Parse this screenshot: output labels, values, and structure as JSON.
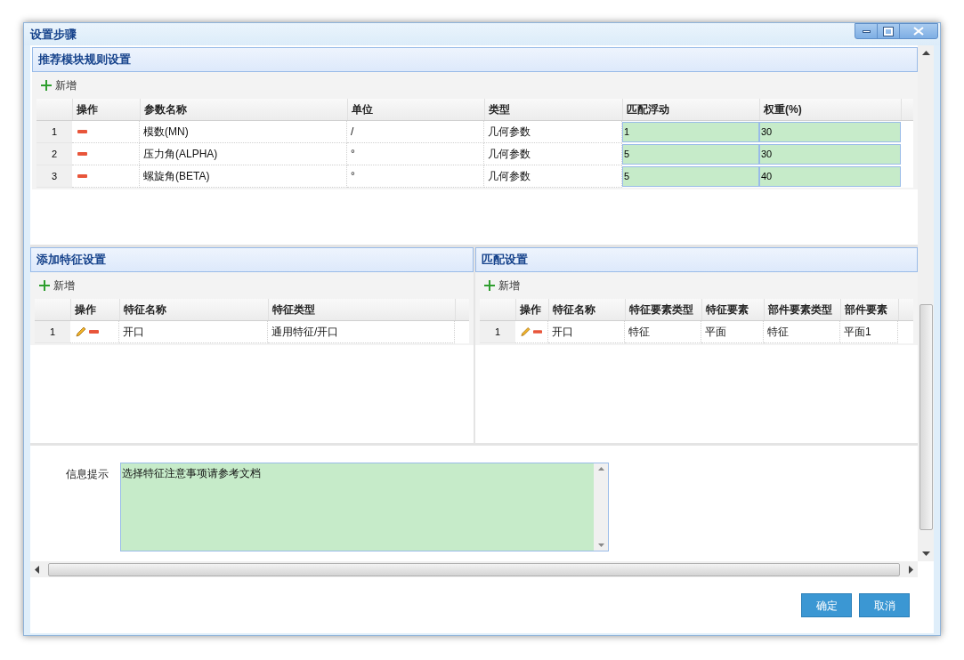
{
  "window": {
    "title": "设置步骤"
  },
  "rule_section": {
    "title": "推荐模块规则设置",
    "add_label": "新增",
    "columns": [
      "操作",
      "参数名称",
      "单位",
      "类型",
      "匹配浮动",
      "权重(%)"
    ],
    "rows": [
      {
        "index": "1",
        "actions": [
          {
            "kind": "delete"
          }
        ],
        "name": "模数(MN)",
        "unit": "/",
        "type": "几何参数",
        "tolerance": "1",
        "weight": "30"
      },
      {
        "index": "2",
        "actions": [
          {
            "kind": "delete"
          }
        ],
        "name": "压力角(ALPHA)",
        "unit": "°",
        "type": "几何参数",
        "tolerance": "5",
        "weight": "30"
      },
      {
        "index": "3",
        "actions": [
          {
            "kind": "delete"
          }
        ],
        "name": "螺旋角(BETA)",
        "unit": "°",
        "type": "几何参数",
        "tolerance": "5",
        "weight": "40"
      }
    ]
  },
  "feature_section": {
    "title": "添加特征设置",
    "add_label": "新增",
    "columns": [
      "操作",
      "特征名称",
      "特征类型"
    ],
    "rows": [
      {
        "index": "1",
        "actions": [
          {
            "kind": "edit"
          },
          {
            "kind": "delete"
          }
        ],
        "name": "开口",
        "type": "通用特征/开口"
      }
    ]
  },
  "match_section": {
    "title": "匹配设置",
    "add_label": "新增",
    "columns": [
      "操作",
      "特征名称",
      "特征要素类型",
      "特征要素",
      "部件要素类型",
      "部件要素"
    ],
    "rows": [
      {
        "index": "1",
        "actions": [
          {
            "kind": "edit"
          },
          {
            "kind": "delete"
          }
        ],
        "name": "开口",
        "feature_element_type": "特征",
        "feature_element": "平面",
        "part_element_type": "特征",
        "part_element": "平面1"
      }
    ]
  },
  "info": {
    "label": "信息提示",
    "value": "选择特征注意事项请参考文档"
  },
  "buttons": [
    {
      "label": "确定"
    },
    {
      "label": "取消"
    }
  ]
}
